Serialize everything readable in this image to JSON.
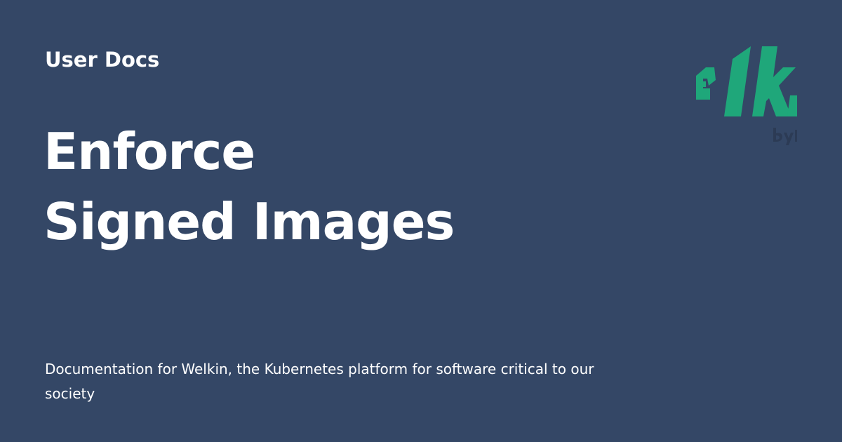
{
  "header": {
    "section_label": "User Docs"
  },
  "main": {
    "title_lines": [
      "Enforce",
      "Signed Images"
    ],
    "description": "Documentation for Welkin, the Kubernetes platform for software critical to our society"
  },
  "logo": {
    "name": "welkin-logo",
    "colors": {
      "wordmark": "#1fa77a",
      "byline": "#2c3b55"
    }
  },
  "colors": {
    "background": "#344766",
    "text": "#ffffff"
  }
}
